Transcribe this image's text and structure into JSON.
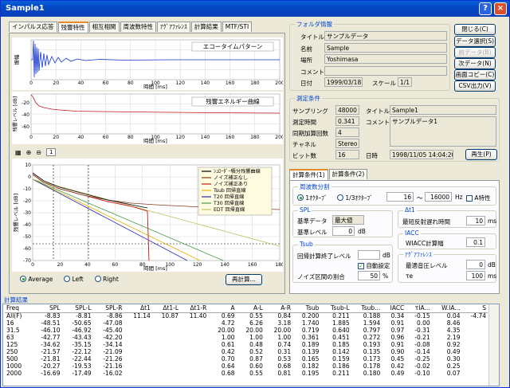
{
  "window": {
    "title": "Sample1"
  },
  "tabs": [
    "インパルス応答",
    "残響特性",
    "相互相関",
    "周波数特性",
    "ｱｸﾞｱﾌｧﾚﾝｽ",
    "計算結果",
    "MTF/STI"
  ],
  "charts": {
    "echo_title": "エコータイムパターン",
    "energy_title": "残響エネルギー曲線",
    "x_label": "時間 [ms]",
    "y_label_echo": "振幅",
    "y_label_energy": "残響レベル [dB]",
    "y_label_decay": "残響レベル [dB]",
    "x_ticks": [
      "0",
      "20",
      "40",
      "60",
      "80",
      "100",
      "120",
      "140",
      "160",
      "180",
      "200"
    ],
    "x_ticks_decay": [
      "0",
      "20",
      "40",
      "60",
      "80",
      "100",
      "120",
      "140",
      "160",
      "180"
    ],
    "y_ticks_decay": [
      "10",
      "0",
      "-10",
      "-20",
      "-30",
      "-40",
      "-50",
      "-60",
      "-70"
    ],
    "energy_y_ticks": [
      "-20",
      "-40",
      "-60"
    ],
    "decay_legend": [
      "ｼｭﾛｰﾀﾞｰ積分残響曲線",
      "ノイズ補正なし",
      "ノイズ補正あり",
      "Tsub 回帰直線",
      "T20 回帰直線",
      "T30 回帰直線",
      "EDT 回帰直線"
    ],
    "legend_colors": [
      "#000000",
      "#8a3a1a",
      "#c41a1a",
      "#e2b400",
      "#2a2aa8",
      "#4a9a4a",
      "#c0c060"
    ]
  },
  "zoom_value": "1",
  "radio": {
    "average": "Average",
    "left": "Left",
    "right": "Right"
  },
  "recalc_button": "再計算...",
  "folder": {
    "group_title": "フォルダ情報",
    "title_label": "タイトル",
    "title": "サンプルデータ",
    "name_label": "名前",
    "name": "Sample",
    "place_label": "場所",
    "place": "Yoshimasa",
    "comment_label": "コメント",
    "comment": "",
    "date_label": "日付",
    "date": "1999/03/18",
    "scale_label": "スケール",
    "scale": "1/1"
  },
  "side_buttons": [
    "閉じる(C)",
    "データ選択(S)",
    "前データ(B)",
    "次データ(N)",
    "画面コピー(C)",
    "CSV出力(V)"
  ],
  "measure": {
    "group_title": "測定条件",
    "sampling_label": "サンプリング",
    "sampling": "48000",
    "time_label": "測定時間",
    "time": "0.341",
    "avg_label": "同期加算回数",
    "avg": "4",
    "channel_label": "チャネル",
    "channel": "Stereo",
    "bits_label": "ビット数",
    "bits": "16",
    "title_label": "タイトル",
    "title": "Sample1",
    "comment_label": "コメント",
    "comment": "サンプルデータ1",
    "date_label": "日時",
    "date": "1998/11/05 14:04:20",
    "play": "再生(P)"
  },
  "calc_tabs": [
    "計算条件(1)",
    "計算条件(2)"
  ],
  "band": {
    "title": "周波数分割",
    "opt1": "1ｵｸﾀｰﾌﾞ",
    "opt2": "1/3ｵｸﾀｰﾌﾞ",
    "from": "16",
    "to": "16000",
    "unit": "Hz",
    "a_weight": "A特性"
  },
  "spl": {
    "title": "SPL",
    "ref_label": "基準データ",
    "ref": "最大値",
    "level_label": "基準レベル",
    "level": "0",
    "unit": "dB"
  },
  "dt1": {
    "title": "Δt1",
    "label": "最短反射遅れ時間",
    "value": "10",
    "unit": "ms"
  },
  "iacc": {
    "title": "IACC",
    "label": "WIACC計算幅",
    "value": "0.1"
  },
  "tsub": {
    "title": "Tsub",
    "end_label": "回帰計算終了レベル",
    "end": "",
    "unit": "dB",
    "auto": "自動設定",
    "noise_label": "ノイズ区間の割合",
    "noise": "50",
    "noise_unit": "%"
  },
  "apparent": {
    "title": "ｱｸﾞｱﾌｧﾚﾝｽ",
    "max_label": "最適音圧レベル",
    "max": "0",
    "max_unit": "dB",
    "te_label": "τe",
    "te": "100",
    "te_unit": "ms"
  },
  "results": {
    "title": "計算結果",
    "headers": [
      "Freq",
      "SPL",
      "SPL-L",
      "SPL-R",
      "Δt1",
      "Δt1-L",
      "Δt1-R",
      "A",
      "A-L",
      "A-R",
      "Tsub",
      "Tsub-L",
      "Tsub...",
      "IACC",
      "τIA...",
      "W.IA...",
      "S"
    ],
    "rows": [
      [
        "All(F)",
        "-8.83",
        "-8.81",
        "-8.86",
        "11.14",
        "10.87",
        "11.40",
        "0.69",
        "0.55",
        "0.84",
        "0.200",
        "0.211",
        "0.188",
        "0.34",
        "-0.15",
        "0.04",
        "-4.74"
      ],
      [
        "16",
        "-48.51",
        "-50.65",
        "-47.08",
        "",
        "",
        "",
        "4.72",
        "6.26",
        "3.18",
        "1.740",
        "1.885",
        "1.594",
        "0.91",
        "0.00",
        "8.46",
        ""
      ],
      [
        "31.5",
        "-46.10",
        "-46.92",
        "-45.40",
        "",
        "",
        "",
        "20.00",
        "20.00",
        "20.00",
        "0.719",
        "0.640",
        "0.797",
        "0.97",
        "-0.31",
        "4.35",
        ""
      ],
      [
        "63",
        "-42.77",
        "-43.43",
        "-42.20",
        "",
        "",
        "",
        "1.00",
        "1.00",
        "1.00",
        "0.361",
        "0.451",
        "0.272",
        "0.96",
        "-0.21",
        "2.19",
        ""
      ],
      [
        "125",
        "-34.62",
        "-35.15",
        "-34.14",
        "",
        "",
        "",
        "0.61",
        "0.48",
        "0.74",
        "0.189",
        "0.185",
        "0.193",
        "0.91",
        "-0.08",
        "0.92",
        ""
      ],
      [
        "250",
        "-21.57",
        "-22.12",
        "-21.09",
        "",
        "",
        "",
        "0.42",
        "0.52",
        "0.31",
        "0.139",
        "0.142",
        "0.135",
        "0.90",
        "-0.14",
        "0.49",
        ""
      ],
      [
        "500",
        "-21.81",
        "-22.44",
        "-21.26",
        "",
        "",
        "",
        "0.70",
        "0.87",
        "0.53",
        "0.165",
        "0.159",
        "0.173",
        "0.45",
        "-0.25",
        "0.30",
        ""
      ],
      [
        "1000",
        "-20.27",
        "-19.53",
        "-21.16",
        "",
        "",
        "",
        "0.64",
        "0.60",
        "0.68",
        "0.182",
        "0.186",
        "0.178",
        "0.42",
        "-0.02",
        "0.25",
        ""
      ],
      [
        "2000",
        "-16.69",
        "-17.49",
        "-16.02",
        "",
        "",
        "",
        "0.68",
        "0.55",
        "0.81",
        "0.195",
        "0.211",
        "0.180",
        "0.49",
        "-0.10",
        "0.07",
        ""
      ]
    ]
  }
}
